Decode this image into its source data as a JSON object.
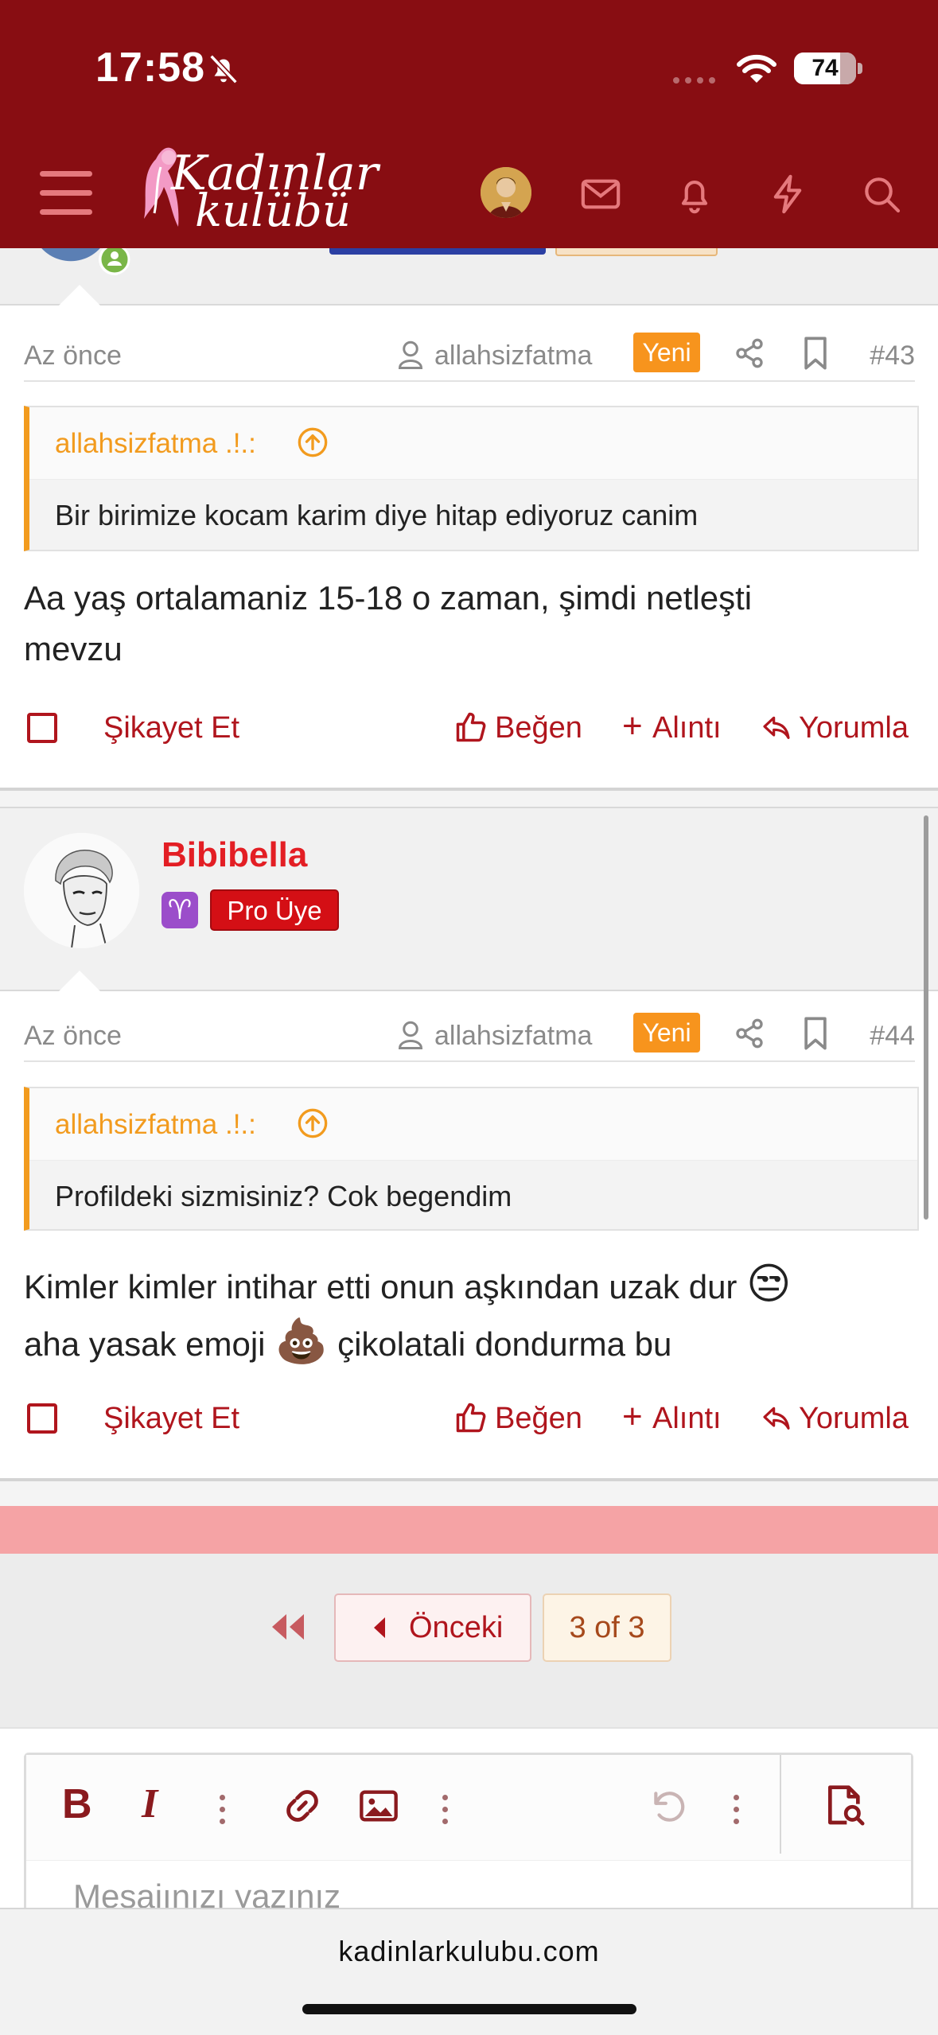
{
  "status_bar": {
    "time": "17:58",
    "battery": "74",
    "battery_level": 0.74
  },
  "header": {
    "logo_line1": "Kadınlar",
    "logo_line2": "kulübü",
    "icons": [
      "menu-icon",
      "mail-icon",
      "bell-icon",
      "lightning-icon",
      "search-icon"
    ]
  },
  "colors": {
    "brand": "#880d12",
    "accent": "#b0151d",
    "new_badge": "#f7941d",
    "quote_border": "#f29b1e",
    "username": "#e31e24"
  },
  "posts": [
    {
      "time": "Az önce",
      "mention_user": "allahsizfatma",
      "badge": "Yeni",
      "number": "#43",
      "quote_author": "allahsizfatma .!.:",
      "quote_text": "Bir birimize kocam karim diye hitap ediyoruz canim",
      "body_line1": "Aa yaş ortalamaniz 15-18 o zaman, şimdi netleşti",
      "body_line2": "mevzu",
      "report": "Şikayet Et",
      "like": "Beğen",
      "quote_btn": "Alıntı",
      "reply": "Yorumla"
    },
    {
      "username": "Bibibella",
      "zodiac": "♈",
      "rank": "Pro Üye",
      "time": "Az önce",
      "mention_user": "allahsizfatma",
      "badge": "Yeni",
      "number": "#44",
      "quote_author": "allahsizfatma .!.:",
      "quote_text": "Profildeki sizmisiniz? Cok begendim",
      "body_line1": "Kimler kimler intihar etti onun aşkından uzak dur",
      "body_line1_emoji": "😒",
      "body_line2_a": "aha yasak emoji",
      "body_line2_emoji": "💩",
      "body_line2_b": "çikolatali dondurma bu",
      "report": "Şikayet Et",
      "like": "Beğen",
      "quote_btn": "Alıntı",
      "reply": "Yorumla"
    }
  ],
  "pagination": {
    "prev": "Önceki",
    "page": "3 of 3"
  },
  "editor": {
    "placeholder": "Mesajınızı yazınız"
  },
  "browser": {
    "url": "kadinlarkulubu.com"
  }
}
